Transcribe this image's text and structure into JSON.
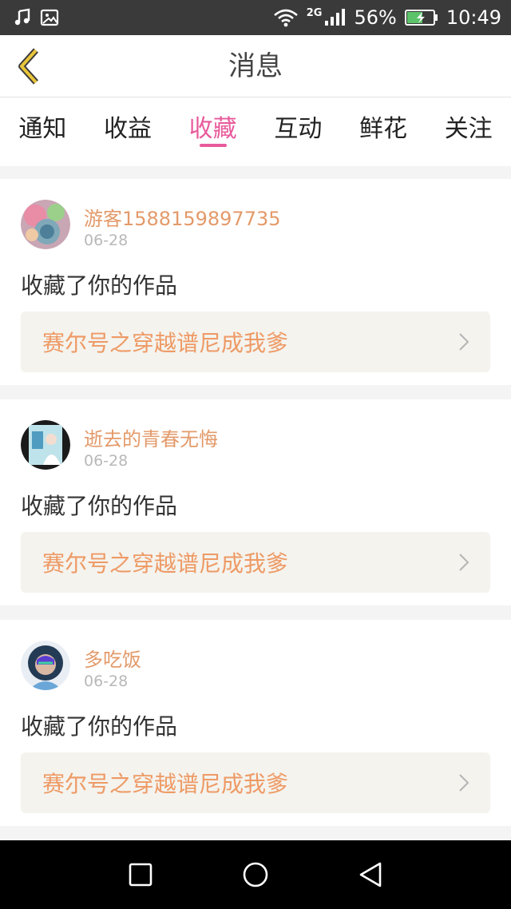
{
  "status_bar": {
    "network_type": "2G",
    "battery_percent": "56%",
    "time": "10:49",
    "icons": [
      "music-icon",
      "gallery-icon",
      "wifi-icon",
      "signal-icon",
      "battery-charging-icon"
    ]
  },
  "header": {
    "title": "消息",
    "back_icon": "chevron-left-icon"
  },
  "tabs": [
    {
      "label": "通知",
      "active": false
    },
    {
      "label": "收益",
      "active": false
    },
    {
      "label": "收藏",
      "active": true
    },
    {
      "label": "互动",
      "active": false
    },
    {
      "label": "鲜花",
      "active": false
    },
    {
      "label": "关注",
      "active": false
    }
  ],
  "messages": [
    {
      "username": "游客1588159897735",
      "date": "06-28",
      "action": "收藏了你的作品",
      "work_title": "赛尔号之穿越谱尼成我爹"
    },
    {
      "username": "逝去的青春无悔",
      "date": "06-28",
      "action": "收藏了你的作品",
      "work_title": "赛尔号之穿越谱尼成我爹"
    },
    {
      "username": "多吃饭",
      "date": "06-28",
      "action": "收藏了你的作品",
      "work_title": "赛尔号之穿越谱尼成我爹"
    }
  ],
  "colors": {
    "accent": "#e85a9b",
    "username": "#e39a6a",
    "work_title": "#ee9a65",
    "back_icon": "#e9c53a"
  },
  "nav_bar": {
    "icons": [
      "recent-apps-icon",
      "home-icon",
      "back-icon"
    ]
  }
}
